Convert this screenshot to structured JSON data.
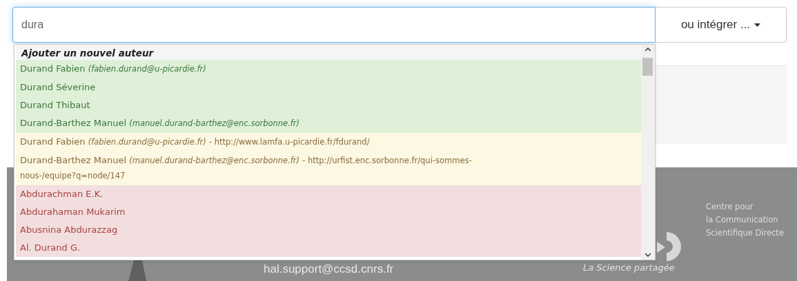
{
  "search": {
    "value": "dura"
  },
  "add_button": {
    "label": "ou intégrer ..."
  },
  "dropdown": {
    "header": "Ajouter un nouvel auteur",
    "items": [
      {
        "kind": "valid",
        "name": "Durand Fabien",
        "email": "(fabien.durand@u-picardie.fr)"
      },
      {
        "kind": "valid",
        "name": "Durand Séverine"
      },
      {
        "kind": "valid",
        "name": "Durand Thibaut"
      },
      {
        "kind": "valid",
        "name": "Durand-Barthez Manuel",
        "email": "(manuel.durand-barthez@enc.sorbonne.fr)"
      },
      {
        "kind": "external",
        "name": "Durand Fabien",
        "email": "(fabien.durand@u-picardie.fr)",
        "url": "- http://www.lamfa.u-picardie.fr/fdurand/"
      },
      {
        "kind": "external",
        "name": "Durand-Barthez Manuel",
        "email": "(manuel.durand-barthez@enc.sorbonne.fr)",
        "url": "- http://urfist.enc.sorbonne.fr/qui-sommes-nous-/equipe?q=node/147"
      },
      {
        "kind": "unverified",
        "name": "Abdurachman E.K."
      },
      {
        "kind": "unverified",
        "name": "Abdurahaman Mukarim"
      },
      {
        "kind": "unverified",
        "name": "Abusnina Abdurazzag"
      },
      {
        "kind": "unverified",
        "name": "Al. Durand G."
      }
    ]
  },
  "footer": {
    "email": "hal.support@ccsd.cnrs.fr",
    "tagline": "La Science partagée",
    "org_lines": [
      "Centre pour",
      "la Communication",
      "Scientifique Directe"
    ]
  }
}
